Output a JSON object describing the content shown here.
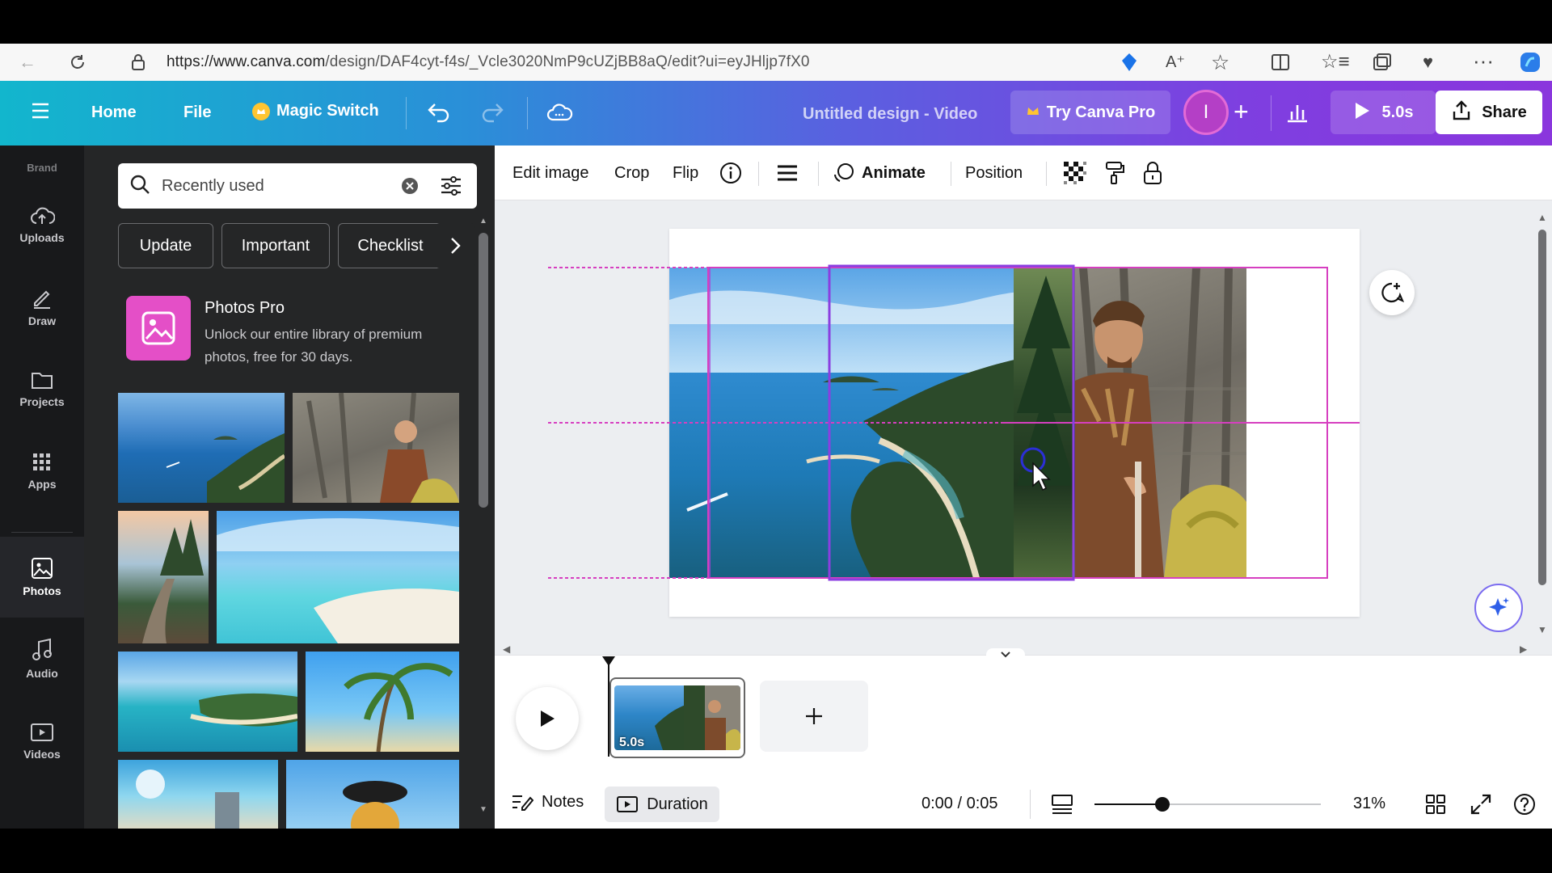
{
  "browser": {
    "url_main": "https://www.canva.com",
    "url_rest": "/design/DAF4cyt-f4s/_Vcle3020NmP9cUZjBB8aQ/edit?ui=eyJHljp7fX0"
  },
  "header": {
    "home": "Home",
    "file": "File",
    "magic_switch": "Magic Switch",
    "title": "Untitled design - Video",
    "try_pro": "Try Canva Pro",
    "avatar_initial": "I",
    "play_duration": "5.0s",
    "share": "Share"
  },
  "rail": {
    "brand": "Brand",
    "uploads": "Uploads",
    "draw": "Draw",
    "projects": "Projects",
    "apps": "Apps",
    "photos": "Photos",
    "audio": "Audio",
    "videos": "Videos"
  },
  "panel": {
    "search_text": "Recently used",
    "chips": [
      "Update",
      "Important",
      "Checklist"
    ],
    "promo_title": "Photos Pro",
    "promo_desc": "Unlock our entire library of premium photos, free for 30 days."
  },
  "toolbar": {
    "edit_image": "Edit image",
    "crop": "Crop",
    "flip": "Flip",
    "animate": "Animate",
    "position": "Position"
  },
  "timeline": {
    "clip_duration": "5.0s"
  },
  "bottom": {
    "notes": "Notes",
    "duration": "Duration",
    "time": "0:00 / 0:05",
    "zoom": "31%",
    "zoom_level": 0.3
  },
  "colors": {
    "header_start": "#12b6cd",
    "header_end": "#8a36dd",
    "guide_magenta": "#e040c8",
    "promo_pink": "#e44fc7",
    "avatar": "#b43fc6"
  }
}
